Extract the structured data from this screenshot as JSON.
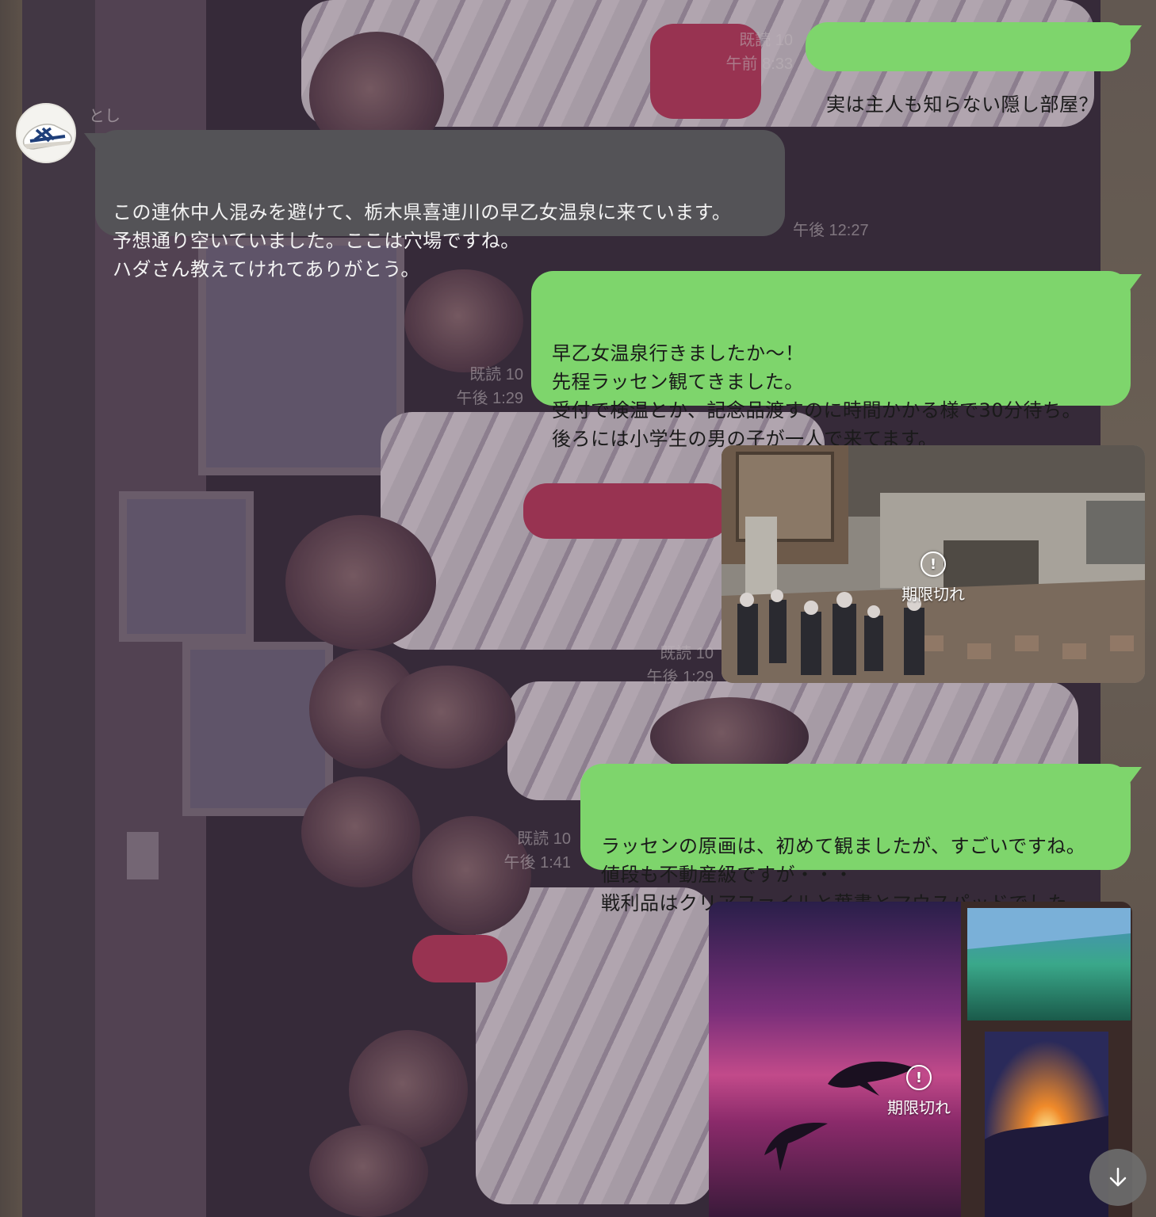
{
  "chat": {
    "contact_name": "とし",
    "messages": [
      {
        "direction": "outgoing",
        "text": "実は主人も知らない隠し部屋？",
        "read": "既読 10",
        "time": "午前 8:33"
      },
      {
        "direction": "incoming",
        "text": "この連休中人混みを避けて、栃木県喜連川の早乙女温泉に来ています。\n予想通り空いていました。ここは穴場ですね。\nハダさん教えてけれてありがとう。",
        "time": "午後 12:27"
      },
      {
        "direction": "outgoing",
        "text": "早乙女温泉行きましたか〜！\n先程ラッセン観てきました。\n受付で検温とか、記念品渡すのに時間かかる様で30分待ち。\n後ろには小学生の男の子が一人で来てます。",
        "read": "既読 10",
        "time": "午後 1:29"
      },
      {
        "direction": "outgoing",
        "type": "image",
        "status": "期限切れ",
        "read": "既読 10",
        "time": "午後 1:29"
      },
      {
        "direction": "outgoing",
        "text": "ラッセンの原画は、初めて観ましたが、すごいですね。\n値段も不動産級ですが・・・\n戦利品はクリアファイルと葉書とマウスパッドでした。",
        "read": "既読 10",
        "time": "午後 1:41"
      },
      {
        "direction": "outgoing",
        "type": "image",
        "status": "期限切れ"
      }
    ]
  },
  "icons": {
    "expired": "exclamation-circle-icon",
    "scroll_down": "arrow-down-icon",
    "avatar": "sneaker-avatar-icon"
  },
  "colors": {
    "outgoing_bubble": "#7ed56c",
    "incoming_bubble": "#545357"
  }
}
